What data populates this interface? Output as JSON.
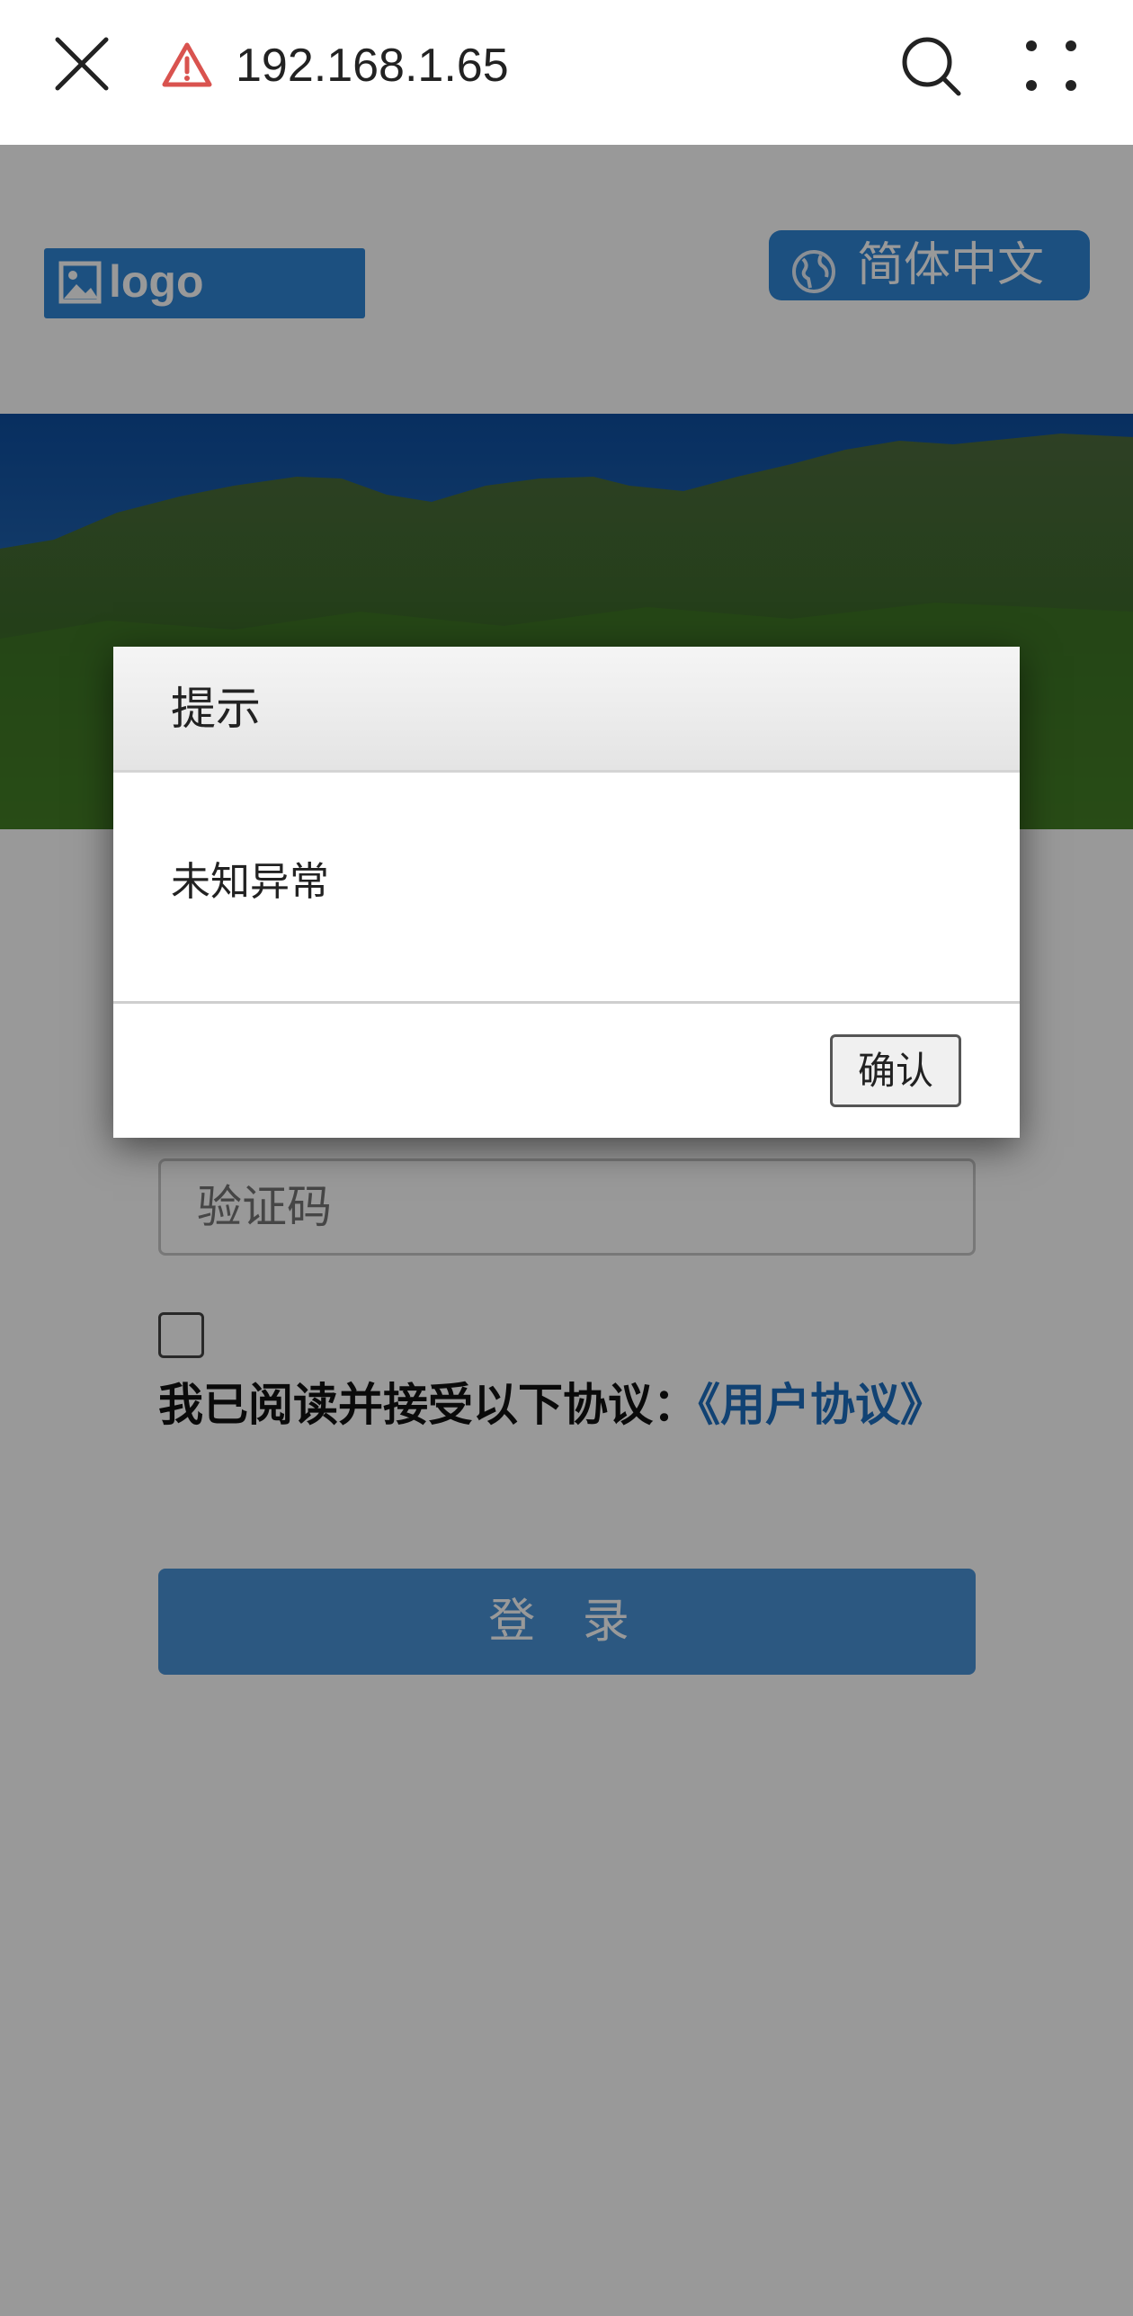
{
  "browser": {
    "url": "192.168.1.65"
  },
  "header": {
    "logo_text": "logo",
    "language": "简体中文"
  },
  "form": {
    "captcha_placeholder": "验证码",
    "agree_text": "我已阅读并接受以下协议：",
    "agreement_link": "《用户协议》",
    "login_label": "登 录"
  },
  "dialog": {
    "title": "提示",
    "message": "未知异常",
    "confirm_label": "确认"
  },
  "colors": {
    "accent": "#2f86d6",
    "link": "#1d6fc0",
    "warning": "#d9534f"
  }
}
